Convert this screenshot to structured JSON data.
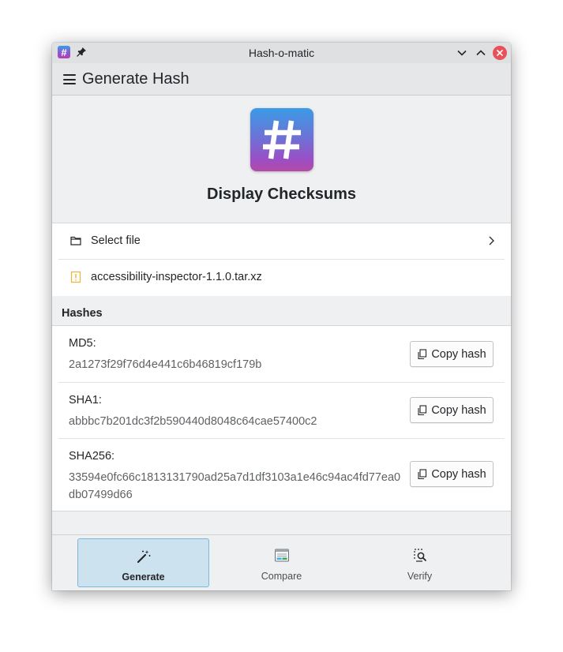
{
  "window": {
    "title": "Hash-o-matic",
    "app_badge": "#"
  },
  "header": {
    "title": "Generate Hash"
  },
  "hero": {
    "title": "Display Checksums",
    "icon": "hash-app-icon"
  },
  "file": {
    "select_label": "Select file",
    "file_name": "accessibility-inspector-1.1.0.tar.xz"
  },
  "hashes": {
    "section_title": "Hashes",
    "copy_label": "Copy hash",
    "items": [
      {
        "name": "MD5:",
        "value": "2a1273f29f76d4e441c6b46819cf179b"
      },
      {
        "name": "SHA1:",
        "value": "abbbc7b201dc3f2b590440d8048c64cae57400c2"
      },
      {
        "name": "SHA256:",
        "value": "33594e0fc66c1813131790ad25a7d1df3103a1e46c94ac4fd77ea0db07499d66"
      }
    ]
  },
  "nav": {
    "items": [
      {
        "label": "Generate",
        "icon": "magic-wand-icon",
        "active": true
      },
      {
        "label": "Compare",
        "icon": "compare-icon",
        "active": false
      },
      {
        "label": "Verify",
        "icon": "verify-icon",
        "active": false
      }
    ]
  },
  "colors": {
    "accent": "#3daee9",
    "nav_active_bg": "#cde2ef",
    "close_button": "#e8515a",
    "warning_icon": "#f0b33a"
  }
}
